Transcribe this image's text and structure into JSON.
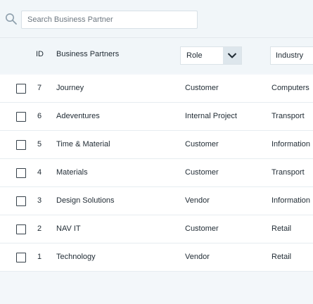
{
  "search": {
    "placeholder": "Search Business Partner",
    "value": ""
  },
  "header": {
    "id_label": "ID",
    "partners_label": "Business Partners",
    "role_label": "Role",
    "industry_label": "Industry"
  },
  "rows": [
    {
      "id": "7",
      "name": "Journey",
      "role": "Customer",
      "industry": "Computers"
    },
    {
      "id": "6",
      "name": "Adeventures",
      "role": "Internal Project",
      "industry": "Transport"
    },
    {
      "id": "5",
      "name": "Time & Material",
      "role": "Customer",
      "industry": "Information"
    },
    {
      "id": "4",
      "name": "Materials",
      "role": "Customer",
      "industry": "Transport"
    },
    {
      "id": "3",
      "name": "Design Solutions",
      "role": "Vendor",
      "industry": "Information"
    },
    {
      "id": "2",
      "name": "NAV IT",
      "role": "Customer",
      "industry": "Retail"
    },
    {
      "id": "1",
      "name": "Technology",
      "role": "Vendor",
      "industry": "Retail"
    }
  ],
  "icons": {
    "search": "search-icon",
    "dropdown": "chevron-down-icon",
    "checkbox": "checkbox-icon"
  },
  "colors": {
    "background": "#f3f7fa",
    "row_background": "#ffffff",
    "text": "#1f2a33",
    "dropdown_button": "#dde6ec"
  }
}
